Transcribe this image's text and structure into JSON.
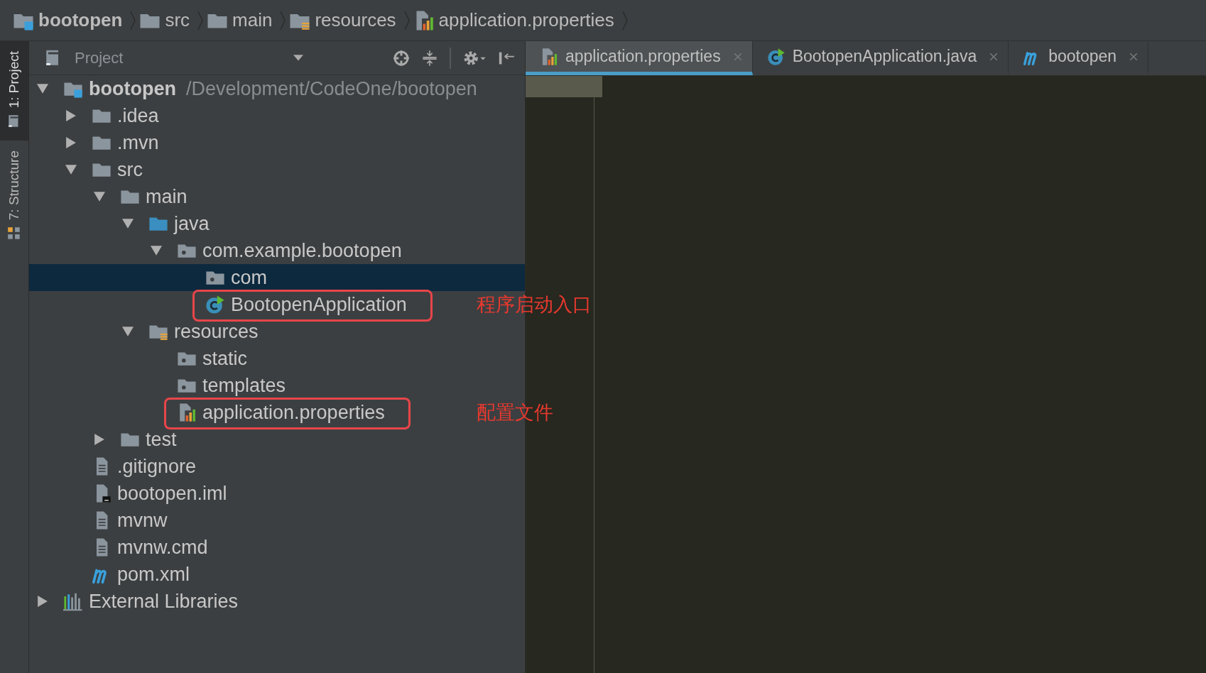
{
  "breadcrumbs": [
    {
      "label": "bootopen",
      "kind": "module",
      "bold": true
    },
    {
      "label": "src",
      "kind": "folder",
      "bold": false
    },
    {
      "label": "main",
      "kind": "folder",
      "bold": false
    },
    {
      "label": "resources",
      "kind": "resources",
      "bold": false
    },
    {
      "label": "application.properties",
      "kind": "properties",
      "bold": false
    }
  ],
  "tool_stripe": [
    {
      "label": "1: Project",
      "kind": "project",
      "selected": true
    },
    {
      "label": "7: Structure",
      "kind": "structure",
      "selected": false
    }
  ],
  "project_panel": {
    "title": "Project",
    "tree": [
      {
        "label": "bootopen",
        "kind": "module",
        "path": "/Development/CodeOne/bootopen",
        "expanded": true,
        "selected": false,
        "children": [
          {
            "label": ".idea",
            "kind": "folder",
            "expanded": false,
            "selected": false
          },
          {
            "label": ".mvn",
            "kind": "folder",
            "expanded": false,
            "selected": false
          },
          {
            "label": "src",
            "kind": "folder",
            "expanded": true,
            "selected": false,
            "children": [
              {
                "label": "main",
                "kind": "folder",
                "expanded": true,
                "selected": false,
                "children": [
                  {
                    "label": "java",
                    "kind": "source",
                    "expanded": true,
                    "selected": false,
                    "children": [
                      {
                        "label": "com.example.bootopen",
                        "kind": "package",
                        "expanded": true,
                        "selected": false,
                        "children": [
                          {
                            "label": "com",
                            "kind": "package",
                            "selected": true
                          },
                          {
                            "label": "BootopenApplication",
                            "kind": "class",
                            "selected": false,
                            "note": "程序启动入口"
                          }
                        ]
                      }
                    ]
                  },
                  {
                    "label": "resources",
                    "kind": "resources",
                    "expanded": true,
                    "selected": false,
                    "children": [
                      {
                        "label": "static",
                        "kind": "package",
                        "selected": false
                      },
                      {
                        "label": "templates",
                        "kind": "package",
                        "selected": false
                      },
                      {
                        "label": "application.properties",
                        "kind": "properties",
                        "selected": false,
                        "note": "配置文件"
                      }
                    ]
                  }
                ]
              },
              {
                "label": "test",
                "kind": "folder",
                "expanded": false,
                "selected": false
              }
            ]
          },
          {
            "label": ".gitignore",
            "kind": "file",
            "selected": false
          },
          {
            "label": "bootopen.iml",
            "kind": "iml",
            "selected": false
          },
          {
            "label": "mvnw",
            "kind": "file",
            "selected": false
          },
          {
            "label": "mvnw.cmd",
            "kind": "file",
            "selected": false
          },
          {
            "label": "pom.xml",
            "kind": "maven",
            "selected": false
          }
        ]
      },
      {
        "label": "External Libraries",
        "kind": "libraries",
        "expanded": false,
        "selected": false
      }
    ]
  },
  "editor_tabs": [
    {
      "label": "application.properties",
      "kind": "properties",
      "selected": true
    },
    {
      "label": "BootopenApplication.java",
      "kind": "class",
      "selected": false
    },
    {
      "label": "bootopen",
      "kind": "maven",
      "selected": false
    }
  ]
}
